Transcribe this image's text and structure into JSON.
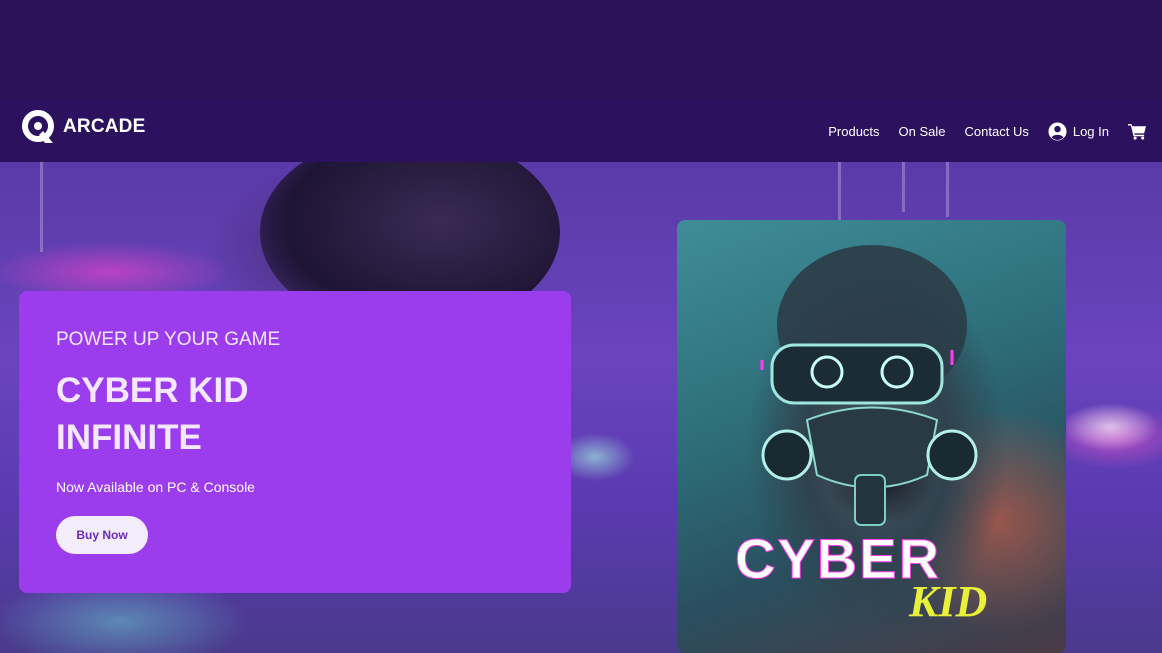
{
  "brand": {
    "name": "ARCADE"
  },
  "nav": {
    "links": [
      "Products",
      "On Sale",
      "Contact Us"
    ],
    "login_label": "Log In"
  },
  "hero": {
    "tagline": "POWER UP YOUR GAME",
    "title_line1": "CYBER KID",
    "title_line2": "INFINITE",
    "availability": "Now Available on PC & Console",
    "cta_label": "Buy Now"
  },
  "cover": {
    "title_main": "CYBER",
    "title_script": "KID"
  },
  "colors": {
    "page_background": "#2a1259",
    "navbar": "#2c125e",
    "promo_card": "#9b3ded",
    "cta_background": "#f3ecfb",
    "cta_text": "#6c2bb8",
    "cover_script": "#e8f03a"
  },
  "icons": [
    "logo-mark-icon",
    "user-circle-icon",
    "shopping-cart-icon"
  ]
}
